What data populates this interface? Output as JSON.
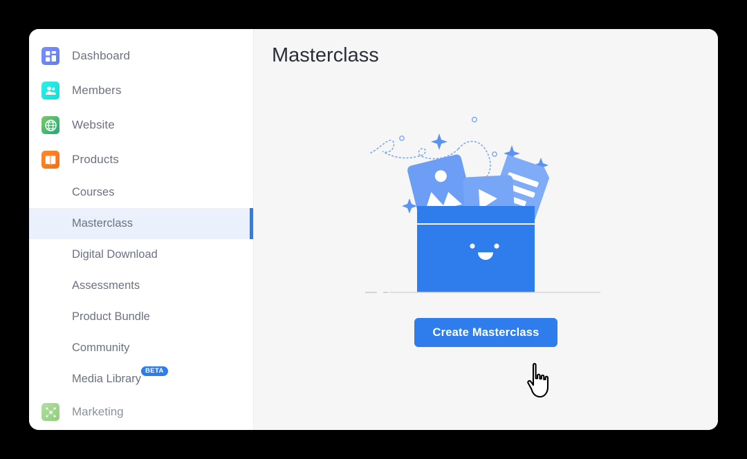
{
  "window": {
    "background_color": "#000000",
    "card_color": "#ffffff",
    "main_background": "#f6f6f7"
  },
  "sidebar": {
    "top_items": [
      {
        "label": "Dashboard",
        "icon": "dashboard-grid-icon",
        "color": "#6b82f3"
      },
      {
        "label": "Members",
        "icon": "members-people-icon",
        "color": "#1fe3dc"
      },
      {
        "label": "Website",
        "icon": "website-globe-icon",
        "color": "#3cb179"
      },
      {
        "label": "Products",
        "icon": "products-book-icon",
        "color": "#f9791a"
      }
    ],
    "sub_items": [
      {
        "label": "Courses",
        "active": false,
        "badge": ""
      },
      {
        "label": "Masterclass",
        "active": true,
        "badge": ""
      },
      {
        "label": "Digital Download",
        "active": false,
        "badge": ""
      },
      {
        "label": "Assessments",
        "active": false,
        "badge": ""
      },
      {
        "label": "Product Bundle",
        "active": false,
        "badge": ""
      },
      {
        "label": "Community",
        "active": false,
        "badge": ""
      },
      {
        "label": "Media Library",
        "active": false,
        "badge": "BETA"
      }
    ],
    "bottom_item": {
      "label": "Marketing",
      "icon": "marketing-network-icon",
      "color": "#9ed48b"
    },
    "active_bg": "#eaf1fd",
    "active_bar": "#2f7ced",
    "badge_color": "#2f7ced"
  },
  "main": {
    "title": "Masterclass",
    "illustration": "empty-box-media-illustration",
    "create_button": "Create Masterclass",
    "accent_color": "#2f7ced"
  },
  "cursor": {
    "type": "pointing-hand-cursor"
  }
}
